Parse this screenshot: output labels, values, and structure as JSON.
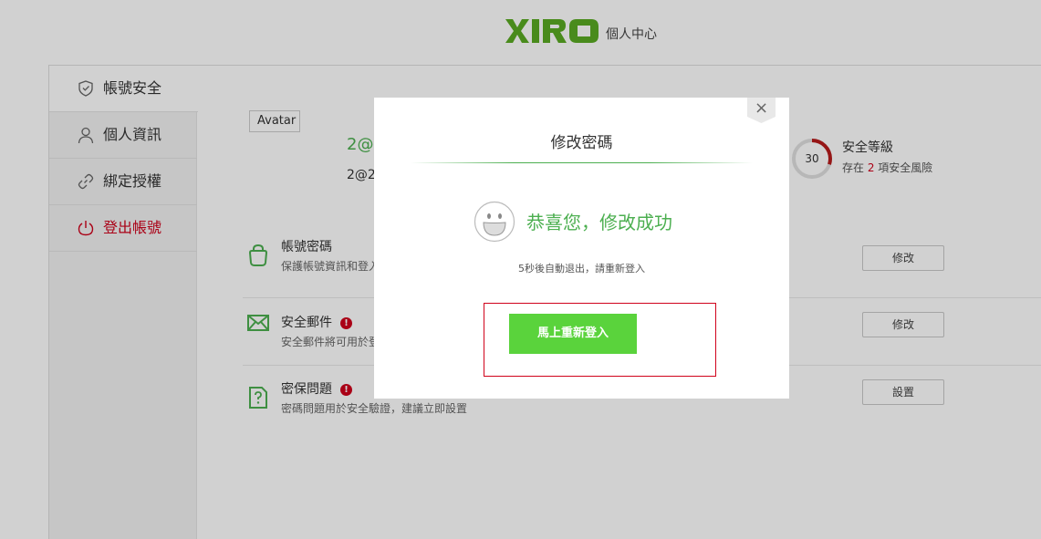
{
  "header": {
    "logo_text": "XIRO",
    "subtitle": "個人中心",
    "logo_color": "#5aaa23"
  },
  "sidebar": {
    "items": [
      {
        "label": "帳號安全",
        "icon": "shield-icon",
        "active": true
      },
      {
        "label": "個人資訊",
        "icon": "person-icon"
      },
      {
        "label": "綁定授權",
        "icon": "link-icon"
      },
      {
        "label": "登出帳號",
        "icon": "power-icon",
        "color": "#d0021b"
      }
    ]
  },
  "profile": {
    "avatar_alt": "Avatar",
    "name": "2@",
    "email": "2@2"
  },
  "security_level": {
    "score": "30",
    "title": "安全等級",
    "desc_prefix": "存在 ",
    "risk_count": "2",
    "desc_suffix": " 項安全風險",
    "ring_color": "#b71c1c",
    "score_fraction": 0.3
  },
  "rows": [
    {
      "title": "帳號密碼",
      "desc": "保護帳號資訊和登入",
      "button": "修改",
      "icon": "bag-icon",
      "warning": false
    },
    {
      "title": "安全郵件",
      "desc": "安全郵件將可用於登",
      "button": "修改",
      "icon": "mail-icon",
      "warning": true
    },
    {
      "title": "密保問題",
      "desc": "密碼問題用於安全驗證，建議立即設置",
      "button": "設置",
      "icon": "question-doc-icon",
      "warning": true
    }
  ],
  "warning_glyph": "!",
  "modal": {
    "close_label": "×",
    "title": "修改密碼",
    "success_message": "恭喜您，修改成功",
    "countdown": "5秒後自動退出，請重新登入",
    "relogin_button": "馬上重新登入",
    "accent": "#4caf50",
    "button_color": "#5ad33c"
  }
}
